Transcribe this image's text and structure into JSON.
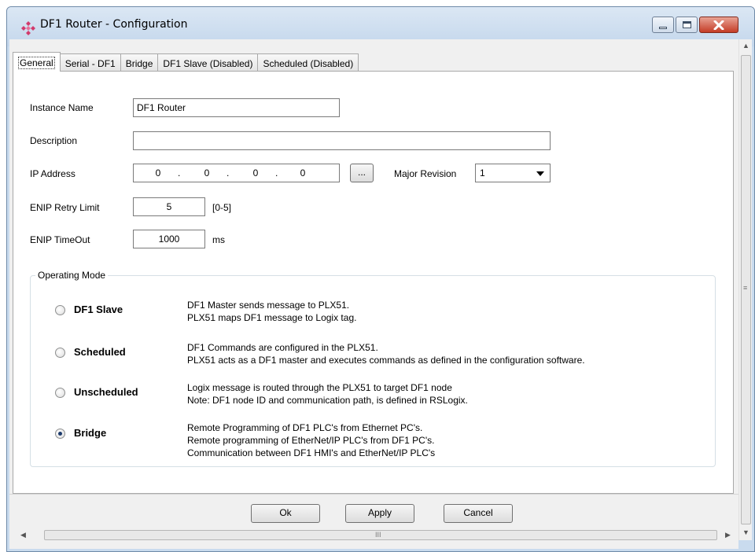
{
  "window": {
    "title": "DF1 Router - Configuration"
  },
  "tabs": [
    {
      "label": "General",
      "active": true
    },
    {
      "label": "Serial - DF1",
      "active": false
    },
    {
      "label": "Bridge",
      "active": false
    },
    {
      "label": "DF1 Slave (Disabled)",
      "active": false
    },
    {
      "label": "Scheduled (Disabled)",
      "active": false
    }
  ],
  "form": {
    "instance_name": {
      "label": "Instance Name",
      "value": "DF1 Router"
    },
    "description": {
      "label": "Description",
      "value": ""
    },
    "ip_address": {
      "label": "IP Address",
      "octets": [
        "0",
        "0",
        "0",
        "0"
      ],
      "dot": ".",
      "browse_label": "..."
    },
    "major_revision": {
      "label": "Major Revision",
      "value": "1"
    },
    "enip_retry_limit": {
      "label": "ENIP Retry Limit",
      "value": "5",
      "range": "[0-5]"
    },
    "enip_timeout": {
      "label": "ENIP TimeOut",
      "value": "1000",
      "unit": "ms"
    }
  },
  "operating_mode": {
    "title": "Operating Mode",
    "options": [
      {
        "name": "DF1 Slave",
        "checked": false,
        "desc": [
          "DF1 Master sends message to PLX51.",
          "PLX51 maps DF1 message to Logix tag."
        ]
      },
      {
        "name": "Scheduled",
        "checked": false,
        "desc": [
          "DF1 Commands are configured in the PLX51.",
          "PLX51 acts as a DF1 master and executes commands as defined in the configuration software."
        ]
      },
      {
        "name": "Unscheduled",
        "checked": false,
        "desc": [
          "Logix message is routed through the PLX51 to target DF1 node",
          "Note: DF1 node ID and communication path, is defined in RSLogix."
        ]
      },
      {
        "name": "Bridge",
        "checked": true,
        "desc": [
          "Remote Programming of DF1 PLC's from Ethernet PC's.",
          "Remote programming of EtherNet/IP PLC's from DF1 PC's.",
          "Communication between DF1 HMI's and EtherNet/IP PLC's"
        ]
      }
    ]
  },
  "buttons": {
    "ok": "Ok",
    "apply": "Apply",
    "cancel": "Cancel"
  },
  "scrollbar": {
    "thumb_grip": "III",
    "side_grip": "≡"
  }
}
